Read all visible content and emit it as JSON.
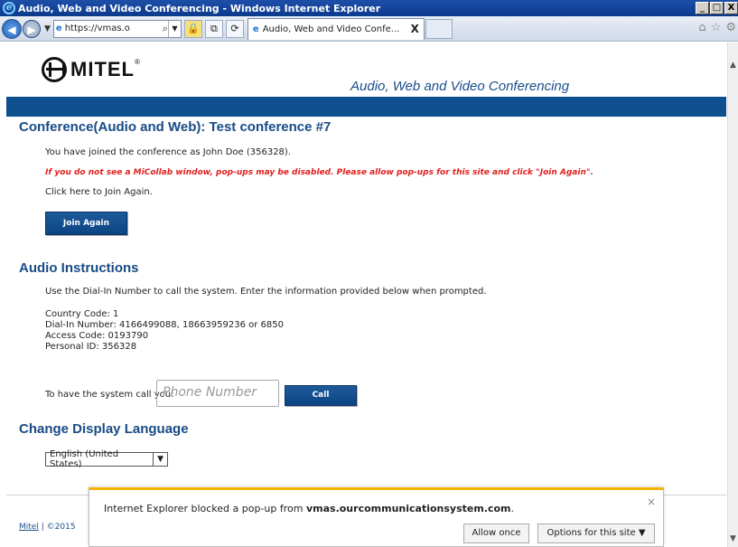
{
  "window": {
    "title": "Audio, Web and Video Conferencing - Windows Internet Explorer",
    "buttons": [
      "_",
      "□",
      "X"
    ]
  },
  "browser": {
    "address": "https://vmas.o",
    "tab_title": "Audio, Web and Video Confe...",
    "tab_close": "X"
  },
  "header": {
    "logo_text": "MITEL",
    "logo_reg": "®",
    "title": "Audio, Web and Video Conferencing"
  },
  "conference": {
    "heading": "Conference(Audio and Web): Test conference #7",
    "joined_text": "You have joined the conference as John Doe (356328).",
    "popup_warning": "If you do not see a MiCollab window, pop-ups may be disabled. Please allow pop-ups for this site and click \"Join Again\".",
    "click_here": "Click here to Join Again.",
    "join_button": "Join Again"
  },
  "audio": {
    "heading": "Audio Instructions",
    "instruction": "Use the Dial-In Number to call the system. Enter the information provided below when prompted.",
    "country_code": "Country Code: 1",
    "dial_in": "Dial-In Number: 4166499088, 18663959236 or 6850",
    "access_code": "Access Code: 0193790",
    "personal_id": "Personal ID: 356328",
    "call_prompt": "To have the system call you:",
    "phone_placeholder": "Phone Number",
    "call_button": "Call"
  },
  "language": {
    "heading": "Change Display Language",
    "selected": "English (United States)"
  },
  "footer": {
    "link": "Mitel",
    "separator": "|",
    "copyright": "©2015"
  },
  "notification": {
    "message_prefix": "Internet Explorer blocked a pop-up from ",
    "domain": "vmas.ourcommunicationsystem.com",
    "message_suffix": ".",
    "allow_once": "Allow once",
    "options": "Options for this site ▼",
    "close": "×"
  }
}
